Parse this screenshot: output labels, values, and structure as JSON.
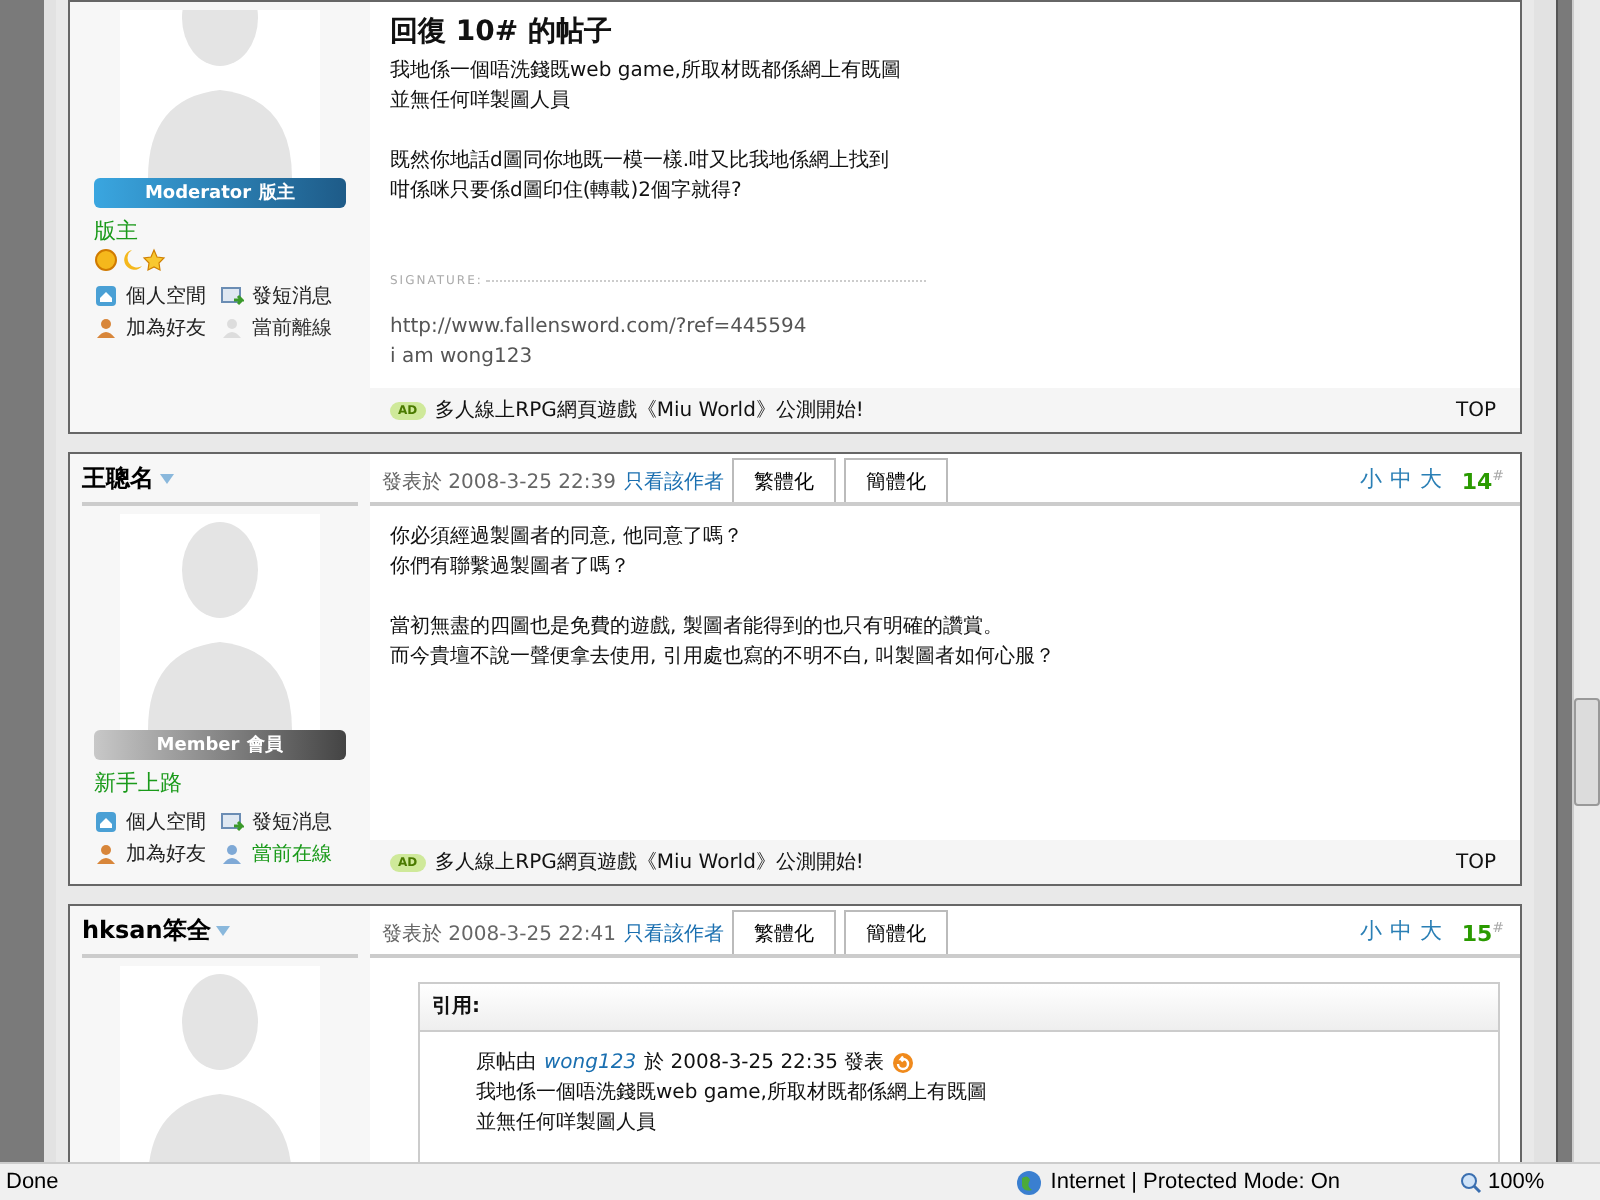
{
  "posts": [
    {
      "title": "回復 10# 的帖子",
      "badge": {
        "kind": "moderator",
        "role": "Moderator",
        "label": "版主"
      },
      "rank": "版主",
      "rank_icons": true,
      "user_links": [
        "個人空間",
        "發短消息",
        "加為好友"
      ],
      "status": {
        "label": "當前離線",
        "online": false
      },
      "body": [
        [
          "我地係一個唔洗錢既web game,所取材既都係網上有既圖",
          "並無任何咩製圖人員"
        ],
        [
          "既然你地話d圖同你地既一模一樣.咁又比我地係網上找到",
          "咁係咪只要係d圖印住(轉載)2個字就得?"
        ]
      ],
      "signature": {
        "label": "SIGNATURE:",
        "lines": [
          "http://www.fallensword.com/?ref=445594",
          "i am wong123"
        ]
      },
      "ad": {
        "badge": "AD",
        "text": "多人線上RPG網頁遊戲《Miu World》公測開始!"
      },
      "top": "TOP"
    },
    {
      "author": "王聰名",
      "posted": "發表於 2008-3-25 22:39",
      "author_only": "只看該作者",
      "tabs": [
        "繁體化",
        "簡體化"
      ],
      "sizes": [
        "小",
        "中",
        "大"
      ],
      "floor": "14",
      "floor_mark": "#",
      "badge": {
        "kind": "member",
        "role": "Member",
        "label": "會員"
      },
      "rank": "新手上路",
      "user_links": [
        "個人空間",
        "發短消息",
        "加為好友"
      ],
      "status": {
        "label": "當前在線",
        "online": true
      },
      "body": [
        [
          "你必須經過製圖者的同意, 他同意了嗎？",
          "你們有聯繫過製圖者了嗎？"
        ],
        [
          "當初無盡的四圖也是免費的遊戲, 製圖者能得到的也只有明確的讚賞。",
          "而今貴壇不說一聲便拿去使用, 引用處也寫的不明不白, 叫製圖者如何心服？"
        ]
      ],
      "ad": {
        "badge": "AD",
        "text": "多人線上RPG網頁遊戲《Miu World》公測開始!"
      },
      "top": "TOP"
    },
    {
      "author": "hksan笨全",
      "posted": "發表於 2008-3-25 22:41",
      "author_only": "只看該作者",
      "tabs": [
        "繁體化",
        "簡體化"
      ],
      "sizes": [
        "小",
        "中",
        "大"
      ],
      "floor": "15",
      "floor_mark": "#",
      "quote": {
        "header": "引用:",
        "origin_prefix": "原帖由",
        "origin_user": "wong123",
        "origin_suffix": "於 2008-3-25 22:35 發表",
        "lines": [
          "我地係一個唔洗錢既web game,所取材既都係網上有既圖",
          "並無任何咩製圖人員"
        ]
      }
    }
  ],
  "status_bar": {
    "text": "Done",
    "zone": "Internet | Protected Mode: On",
    "zoom": "100%"
  }
}
